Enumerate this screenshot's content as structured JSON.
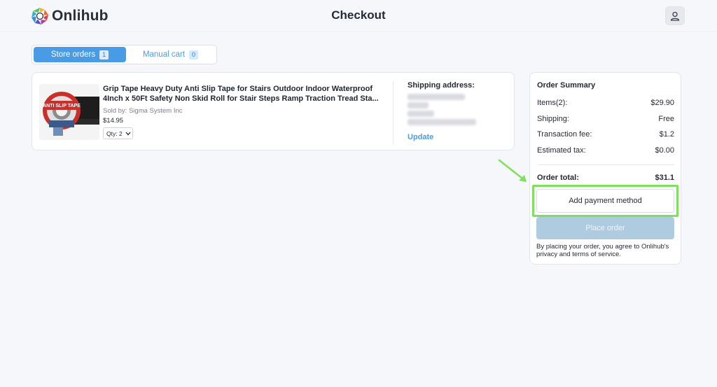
{
  "header": {
    "logo_text": "Onlihub",
    "title": "Checkout",
    "profile_icon": "user-icon"
  },
  "tabs": [
    {
      "label": "Store orders",
      "count": "1",
      "active": true
    },
    {
      "label": "Manual cart",
      "count": "0",
      "active": false
    }
  ],
  "cart_item": {
    "title": "Grip Tape Heavy Duty Anti Slip Tape for Stairs Outdoor Indoor Waterproof 4Inch x 50Ft Safety Non Skid Roll for Stair Steps Ramp Traction Tread Sta...",
    "seller": "Sold by: Sigma System Inc",
    "price": "$14.95",
    "quantity": "Qty: 2",
    "image_text": "ANTI SLIP TAPE"
  },
  "shipping": {
    "title": "Shipping address:",
    "update_label": "Update"
  },
  "summary": {
    "title": "Order Summary",
    "rows": [
      {
        "label": "Items(2):",
        "value": "$29.90"
      },
      {
        "label": "Shipping:",
        "value": "Free"
      },
      {
        "label": "Transaction fee:",
        "value": "$1.2"
      },
      {
        "label": "Estimated tax:",
        "value": "$0.00"
      }
    ],
    "total_label": "Order total:",
    "total_value": "$31.1",
    "add_payment_label": "Add payment method",
    "place_order_label": "Place order",
    "terms_text": "By placing your order, you agree to Onlihub's privacy and terms of service."
  },
  "colors": {
    "accent": "#4a9be6",
    "highlight": "#7ee05b",
    "place_order_disabled": "#aecbe0"
  }
}
